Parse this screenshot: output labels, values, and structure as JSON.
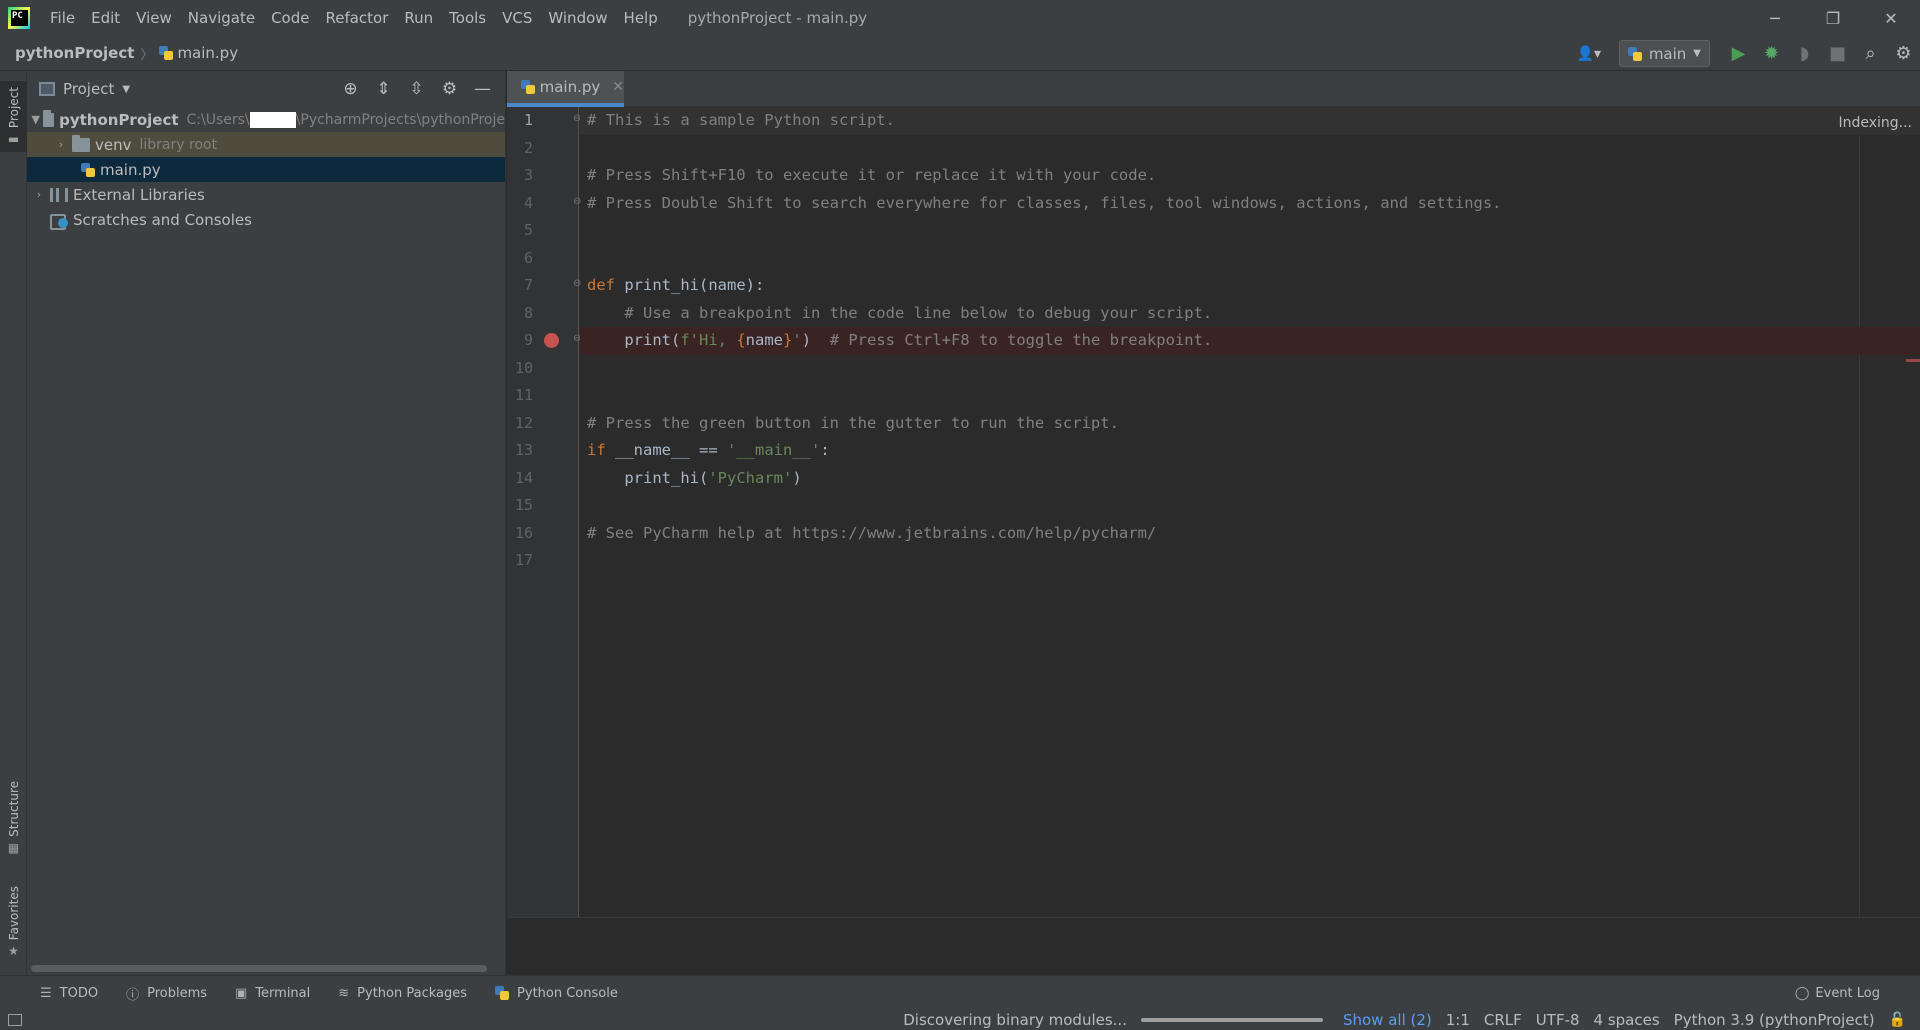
{
  "window": {
    "title": "pythonProject - main.py",
    "menu": [
      "File",
      "Edit",
      "View",
      "Navigate",
      "Code",
      "Refactor",
      "Run",
      "Tools",
      "VCS",
      "Window",
      "Help"
    ],
    "controls": {
      "minimize": "─",
      "restore": "❐",
      "close": "✕"
    }
  },
  "navbar": {
    "project": "pythonProject",
    "file": "main.py",
    "run_config": "main"
  },
  "left_stripe": {
    "project": "Project",
    "structure": "Structure",
    "favorites": "Favorites"
  },
  "project_panel": {
    "title": "Project",
    "tree": [
      {
        "label": "pythonProject",
        "hint_prefix": "C:\\Users\\",
        "hint_suffix": "\\PycharmProjects\\pythonProje"
      },
      {
        "label": "venv",
        "hint": "library root"
      },
      {
        "label": "main.py"
      },
      {
        "label": "External Libraries"
      },
      {
        "label": "Scratches and Consoles"
      }
    ]
  },
  "editor": {
    "tab": "main.py",
    "status": "Indexing...",
    "line_numbers": [
      "1",
      "2",
      "3",
      "4",
      "5",
      "6",
      "7",
      "8",
      "9",
      "10",
      "11",
      "12",
      "13",
      "14",
      "15",
      "16",
      "17"
    ],
    "lines": {
      "l1": "# This is a sample Python script.",
      "l3": "# Press Shift+F10 to execute it or replace it with your code.",
      "l4": "# Press Double Shift to search everywhere for classes, files, tool windows, actions, and settings.",
      "l7_kw": "def",
      "l7_rest": " print_hi(name):",
      "l8": "    # Use a breakpoint in the code line below to debug your script.",
      "l9_a": "    print(",
      "l9_str1": "f'Hi, ",
      "l9_b1": "{",
      "l9_name": "name",
      "l9_b2": "}",
      "l9_str2": "'",
      "l9_c": ")  ",
      "l9_comment": "# Press Ctrl+F8 to toggle the breakpoint.",
      "l12": "# Press the green button in the gutter to run the script.",
      "l13_kw": "if",
      "l13_mid": " __name__ == ",
      "l13_str": "'__main__'",
      "l13_end": ":",
      "l14_a": "    print_hi(",
      "l14_str": "'PyCharm'",
      "l14_b": ")",
      "l16": "# See PyCharm help at https://www.jetbrains.com/help/pycharm/"
    }
  },
  "bottom_tools": {
    "todo": "TODO",
    "problems": "Problems",
    "terminal": "Terminal",
    "packages": "Python Packages",
    "console": "Python Console",
    "event_log": "Event Log"
  },
  "statusbar": {
    "task": "Discovering binary modules...",
    "show_all": "Show all (2)",
    "position": "1:1",
    "line_sep": "CRLF",
    "encoding": "UTF-8",
    "indent": "4 spaces",
    "interpreter": "Python 3.9 (pythonProject)"
  }
}
